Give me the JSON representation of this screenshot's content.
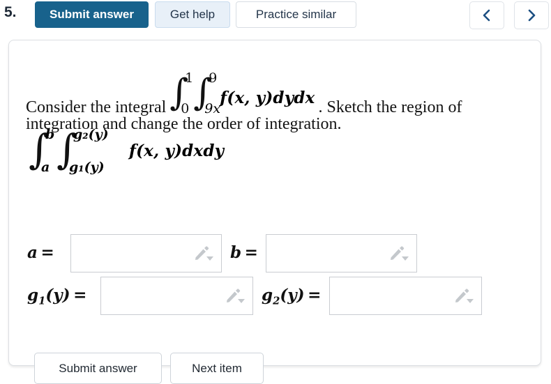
{
  "question_number": "5.",
  "toolbar": {
    "submit_label": "Submit answer",
    "help_label": "Get help",
    "practice_label": "Practice similar",
    "prev_icon": "chevron-left-icon",
    "next_icon": "chevron-right-icon",
    "submit_bg": "#18628c",
    "help_bg": "#e8f0f8",
    "chevron_color": "#1c4f82"
  },
  "problem": {
    "text_before": "Consider the integral",
    "integral1": {
      "outer_lower": "0",
      "outer_upper": "1",
      "inner_lower": "9x",
      "inner_upper": "9",
      "integrand": "f(x, y)dydx"
    },
    "text_after": ". Sketch the region of",
    "line2": "integration and change the order of integration.",
    "integral2": {
      "outer_lower": "a",
      "outer_upper": "b",
      "inner_lower": "g₁(y)",
      "inner_upper": "g₂(y)",
      "integrand": "f(x, y)dxdy"
    }
  },
  "answers": {
    "fields": [
      {
        "label_main": "a",
        "label_sub": "",
        "label_eq": " =",
        "value": "",
        "placeholder": "",
        "icon": "pencil-dropdown-icon"
      },
      {
        "label_main": "b",
        "label_sub": "",
        "label_eq": " =",
        "value": "",
        "placeholder": "",
        "icon": "pencil-dropdown-icon"
      },
      {
        "label_main": "g",
        "label_sub": "1",
        "label_eq": "(y) =",
        "value": "",
        "placeholder": "",
        "icon": "pencil-dropdown-icon"
      },
      {
        "label_main": "g",
        "label_sub": "2",
        "label_eq": "(y) =",
        "value": "",
        "placeholder": "",
        "icon": "pencil-dropdown-icon"
      }
    ]
  },
  "footer": {
    "submit_label": "Submit answer",
    "next_label": "Next item"
  }
}
